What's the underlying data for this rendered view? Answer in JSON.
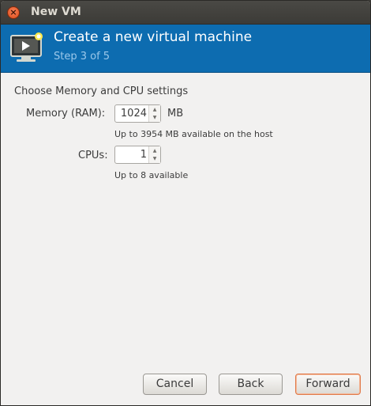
{
  "window": {
    "title": "New VM",
    "close_glyph": "×"
  },
  "header": {
    "title": "Create a new virtual machine",
    "step": "Step 3 of 5",
    "icon": "vm-monitor-icon"
  },
  "form": {
    "section_label": "Choose Memory and CPU settings",
    "memory": {
      "label": "Memory (RAM):",
      "value": "1024",
      "unit": "MB",
      "hint": "Up to 3954 MB available on the host"
    },
    "cpus": {
      "label": "CPUs:",
      "value": "1",
      "hint": "Up to 8 available"
    }
  },
  "buttons": {
    "cancel": "Cancel",
    "back": "Back",
    "forward": "Forward"
  },
  "colors": {
    "header_bg": "#0d6cb0",
    "title_bar": "#3c3b37",
    "close_button": "#df4a16",
    "default_button_border": "#e07a4a"
  }
}
